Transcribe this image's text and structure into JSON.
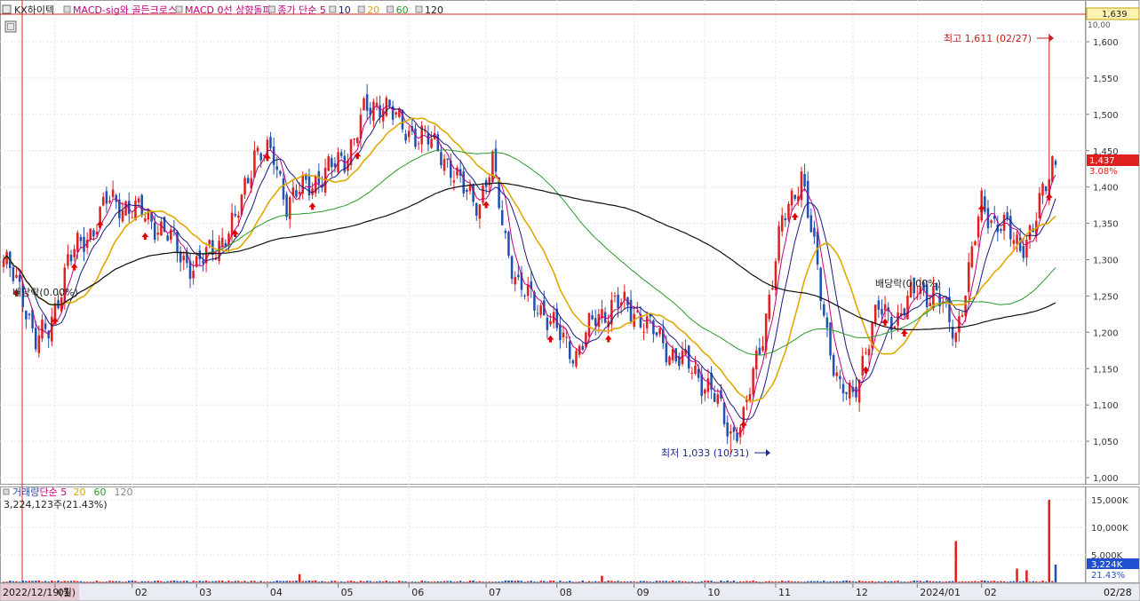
{
  "header": {
    "stock_name": "KX하이텍",
    "indicators": [
      {
        "text": "MACD-sig와 골든크로스",
        "color": "#c0007a"
      },
      {
        "text": "MACD 0선 상향돌파",
        "color": "#c0007a"
      },
      {
        "text": "종가 단순 5",
        "color": "#c0007a"
      },
      {
        "text": "10",
        "color": "#1a1a80"
      },
      {
        "text": "20",
        "color": "#e0a000"
      },
      {
        "text": "60",
        "color": "#2a9a2a"
      },
      {
        "text": "120",
        "color": "#222222"
      }
    ],
    "scale_label": "10,00",
    "current_price_tag": "1,639"
  },
  "price_panel": {
    "high_annotation": "최고 1,611 (02/27)",
    "low_annotation": "최저 1,033 (10/31)",
    "dividend_labels": [
      "배당락(0.00%)",
      "배당락(0.00%)"
    ],
    "last_price_tag": "1,437",
    "last_change_tag": "3.08%"
  },
  "volume_panel": {
    "legend": [
      {
        "text": "거래량",
        "color": "#2a4aa0"
      },
      {
        "text": "단순 5",
        "color": "#c0007a"
      },
      {
        "text": "20",
        "color": "#e0a000"
      },
      {
        "text": "60",
        "color": "#2a9a2a"
      },
      {
        "text": "120",
        "color": "#888888"
      }
    ],
    "current_volume_text": "3,224,123주(21.43%)",
    "last_volume_tag": "3,224K",
    "last_volume_pct": "21.43%"
  },
  "x_axis": {
    "start_label": "2022/12/19(월)",
    "end_label": "02/28"
  },
  "colors": {
    "up": "#e02020",
    "down": "#2050b0",
    "ma5": "#c0007a",
    "ma10": "#1a1a80",
    "ma20": "#e0a800",
    "ma60": "#2a9a2a",
    "ma120": "#111111"
  },
  "chart_data": {
    "type": "candlestick",
    "price_axis": {
      "min": 1000,
      "max": 1600,
      "ticks": [
        1000,
        1050,
        1100,
        1150,
        1200,
        1250,
        1300,
        1350,
        1400,
        1450,
        1500,
        1550,
        1600
      ],
      "tick_labels": [
        "1,000",
        "1,050",
        "1,100",
        "1,150",
        "1,200",
        "1,250",
        "1,300",
        "1,350",
        "1,400",
        "1,450",
        "1,500",
        "1,550",
        "1,600"
      ]
    },
    "volume_axis": {
      "min": 0,
      "max": 15000,
      "ticks": [
        5000,
        10000,
        15000
      ],
      "tick_labels": [
        "5,000K",
        "10,000K",
        "15,000K"
      ]
    },
    "months": [
      "01",
      "02",
      "03",
      "04",
      "05",
      "06",
      "07",
      "08",
      "09",
      "10",
      "11",
      "12",
      "2024/01",
      "02"
    ],
    "close_key_points": [
      [
        0,
        1300
      ],
      [
        6,
        1250
      ],
      [
        10,
        1190
      ],
      [
        14,
        1200
      ],
      [
        20,
        1300
      ],
      [
        26,
        1330
      ],
      [
        32,
        1380
      ],
      [
        38,
        1375
      ],
      [
        44,
        1360
      ],
      [
        50,
        1340
      ],
      [
        56,
        1300
      ],
      [
        60,
        1290
      ],
      [
        66,
        1320
      ],
      [
        72,
        1350
      ],
      [
        78,
        1450
      ],
      [
        84,
        1440
      ],
      [
        88,
        1380
      ],
      [
        94,
        1400
      ],
      [
        100,
        1420
      ],
      [
        106,
        1440
      ],
      [
        112,
        1500
      ],
      [
        118,
        1520
      ],
      [
        124,
        1480
      ],
      [
        130,
        1470
      ],
      [
        136,
        1450
      ],
      [
        142,
        1400
      ],
      [
        148,
        1380
      ],
      [
        152,
        1430
      ],
      [
        156,
        1330
      ],
      [
        160,
        1260
      ],
      [
        166,
        1240
      ],
      [
        172,
        1200
      ],
      [
        178,
        1170
      ],
      [
        184,
        1220
      ],
      [
        190,
        1240
      ],
      [
        196,
        1230
      ],
      [
        202,
        1200
      ],
      [
        208,
        1170
      ],
      [
        214,
        1150
      ],
      [
        220,
        1120
      ],
      [
        226,
        1060
      ],
      [
        230,
        1080
      ],
      [
        236,
        1200
      ],
      [
        242,
        1350
      ],
      [
        248,
        1420
      ],
      [
        252,
        1310
      ],
      [
        256,
        1200
      ],
      [
        260,
        1120
      ],
      [
        264,
        1110
      ],
      [
        268,
        1180
      ],
      [
        272,
        1230
      ],
      [
        278,
        1220
      ],
      [
        284,
        1260
      ],
      [
        290,
        1250
      ],
      [
        296,
        1200
      ],
      [
        300,
        1280
      ],
      [
        304,
        1380
      ],
      [
        308,
        1350
      ],
      [
        312,
        1340
      ],
      [
        316,
        1320
      ],
      [
        320,
        1340
      ],
      [
        323,
        1390
      ],
      [
        326,
        1437
      ]
    ],
    "high": {
      "value": 1611,
      "date": "02/27"
    },
    "low": {
      "value": 1033,
      "date": "10/31"
    },
    "last_close": 1437,
    "last_change_pct": 3.08,
    "last_volume_k": 3224,
    "volume_spikes_k": [
      [
        92,
        1500
      ],
      [
        186,
        1200
      ],
      [
        296,
        7500
      ],
      [
        315,
        2500
      ],
      [
        318,
        2200
      ],
      [
        325,
        15000
      ],
      [
        327,
        3224
      ]
    ]
  }
}
